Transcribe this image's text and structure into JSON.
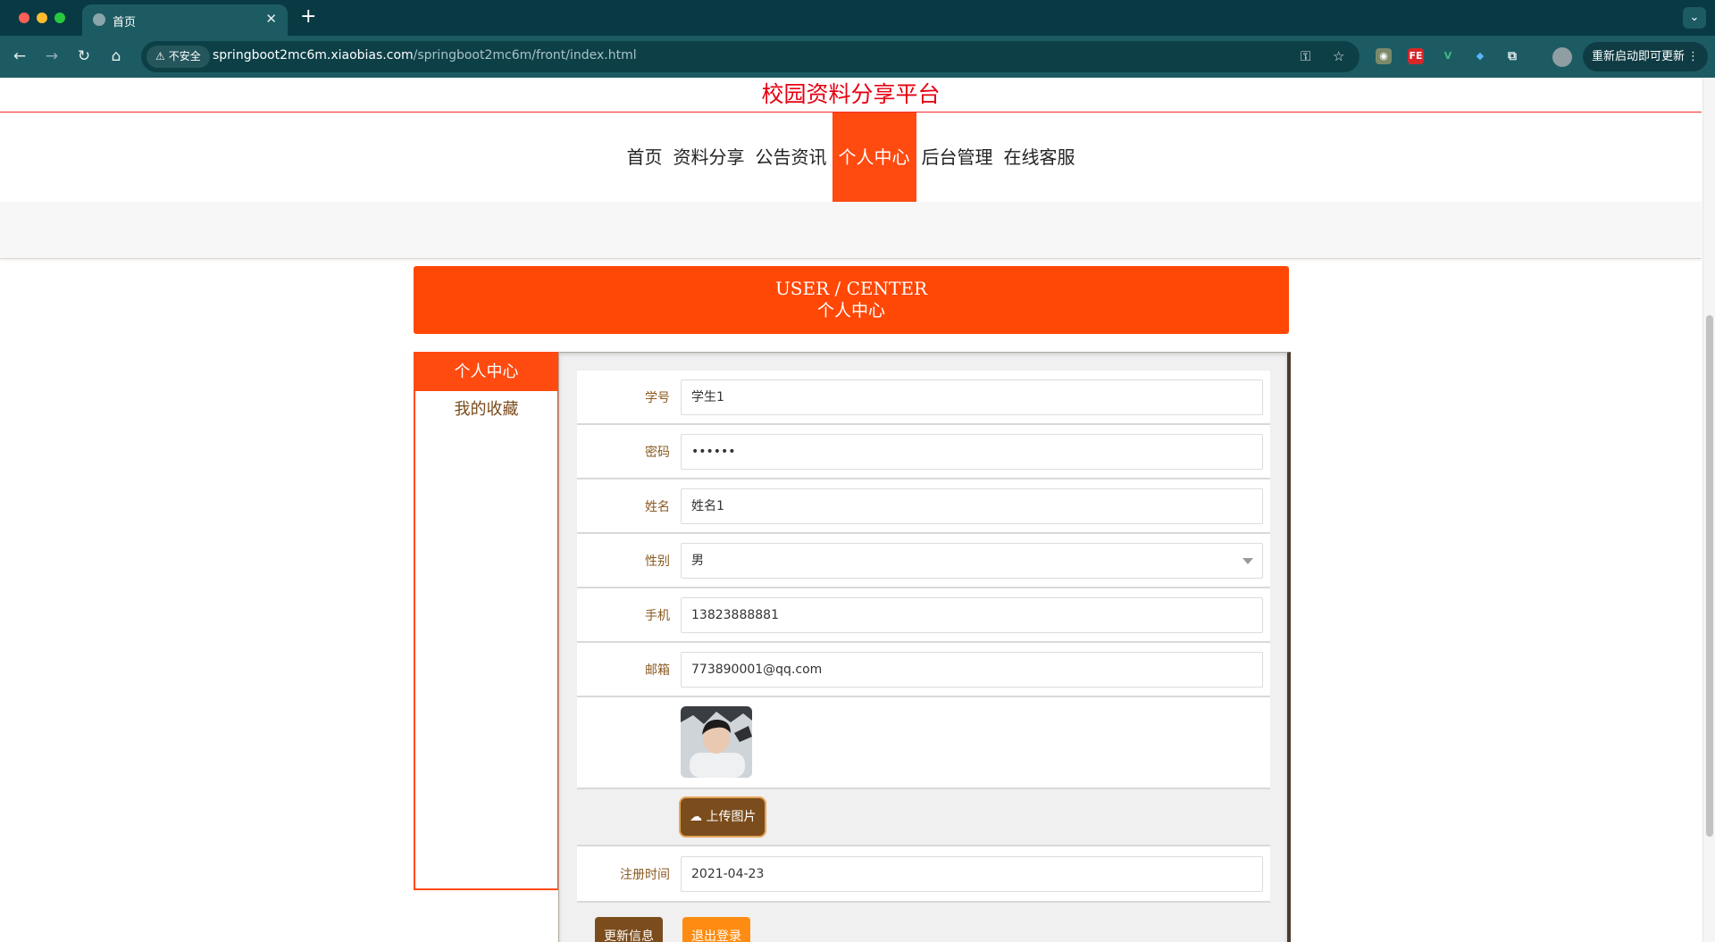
{
  "browser": {
    "tab_title": "首页",
    "insecure_label": "不安全",
    "url_host": "springboot2mc6m.xiaobias.com",
    "url_path": "/springboot2mc6m/front/index.html",
    "relaunch_label": "重新启动即可更新",
    "ext_fe": "FE",
    "ext_v": "V"
  },
  "site": {
    "title": "校园资料分享平台",
    "title_color": "#e60012",
    "accent_color": "#ff4a10"
  },
  "nav": {
    "items": [
      {
        "label": "首页"
      },
      {
        "label": "资料分享"
      },
      {
        "label": "公告资讯"
      },
      {
        "label": "个人中心"
      },
      {
        "label": "后台管理"
      },
      {
        "label": "在线客服"
      }
    ],
    "active_index": 3
  },
  "banner": {
    "title_en": "USER / CENTER",
    "title_zh": "个人中心"
  },
  "sidebar": {
    "items": [
      {
        "label": "个人中心"
      },
      {
        "label": "我的收藏"
      }
    ]
  },
  "form": {
    "student_id": {
      "label": "学号",
      "value": "学生1"
    },
    "password": {
      "label": "密码",
      "value": "••••••"
    },
    "name": {
      "label": "姓名",
      "value": "姓名1"
    },
    "gender": {
      "label": "性别",
      "value": "男"
    },
    "phone": {
      "label": "手机",
      "value": "13823888881"
    },
    "email": {
      "label": "邮箱",
      "value": "773890001@qq.com"
    },
    "upload_label": "上传图片",
    "register_time": {
      "label": "注册时间",
      "value": "2021-04-23"
    },
    "update_button": "更新信息",
    "logout_button": "退出登录"
  }
}
